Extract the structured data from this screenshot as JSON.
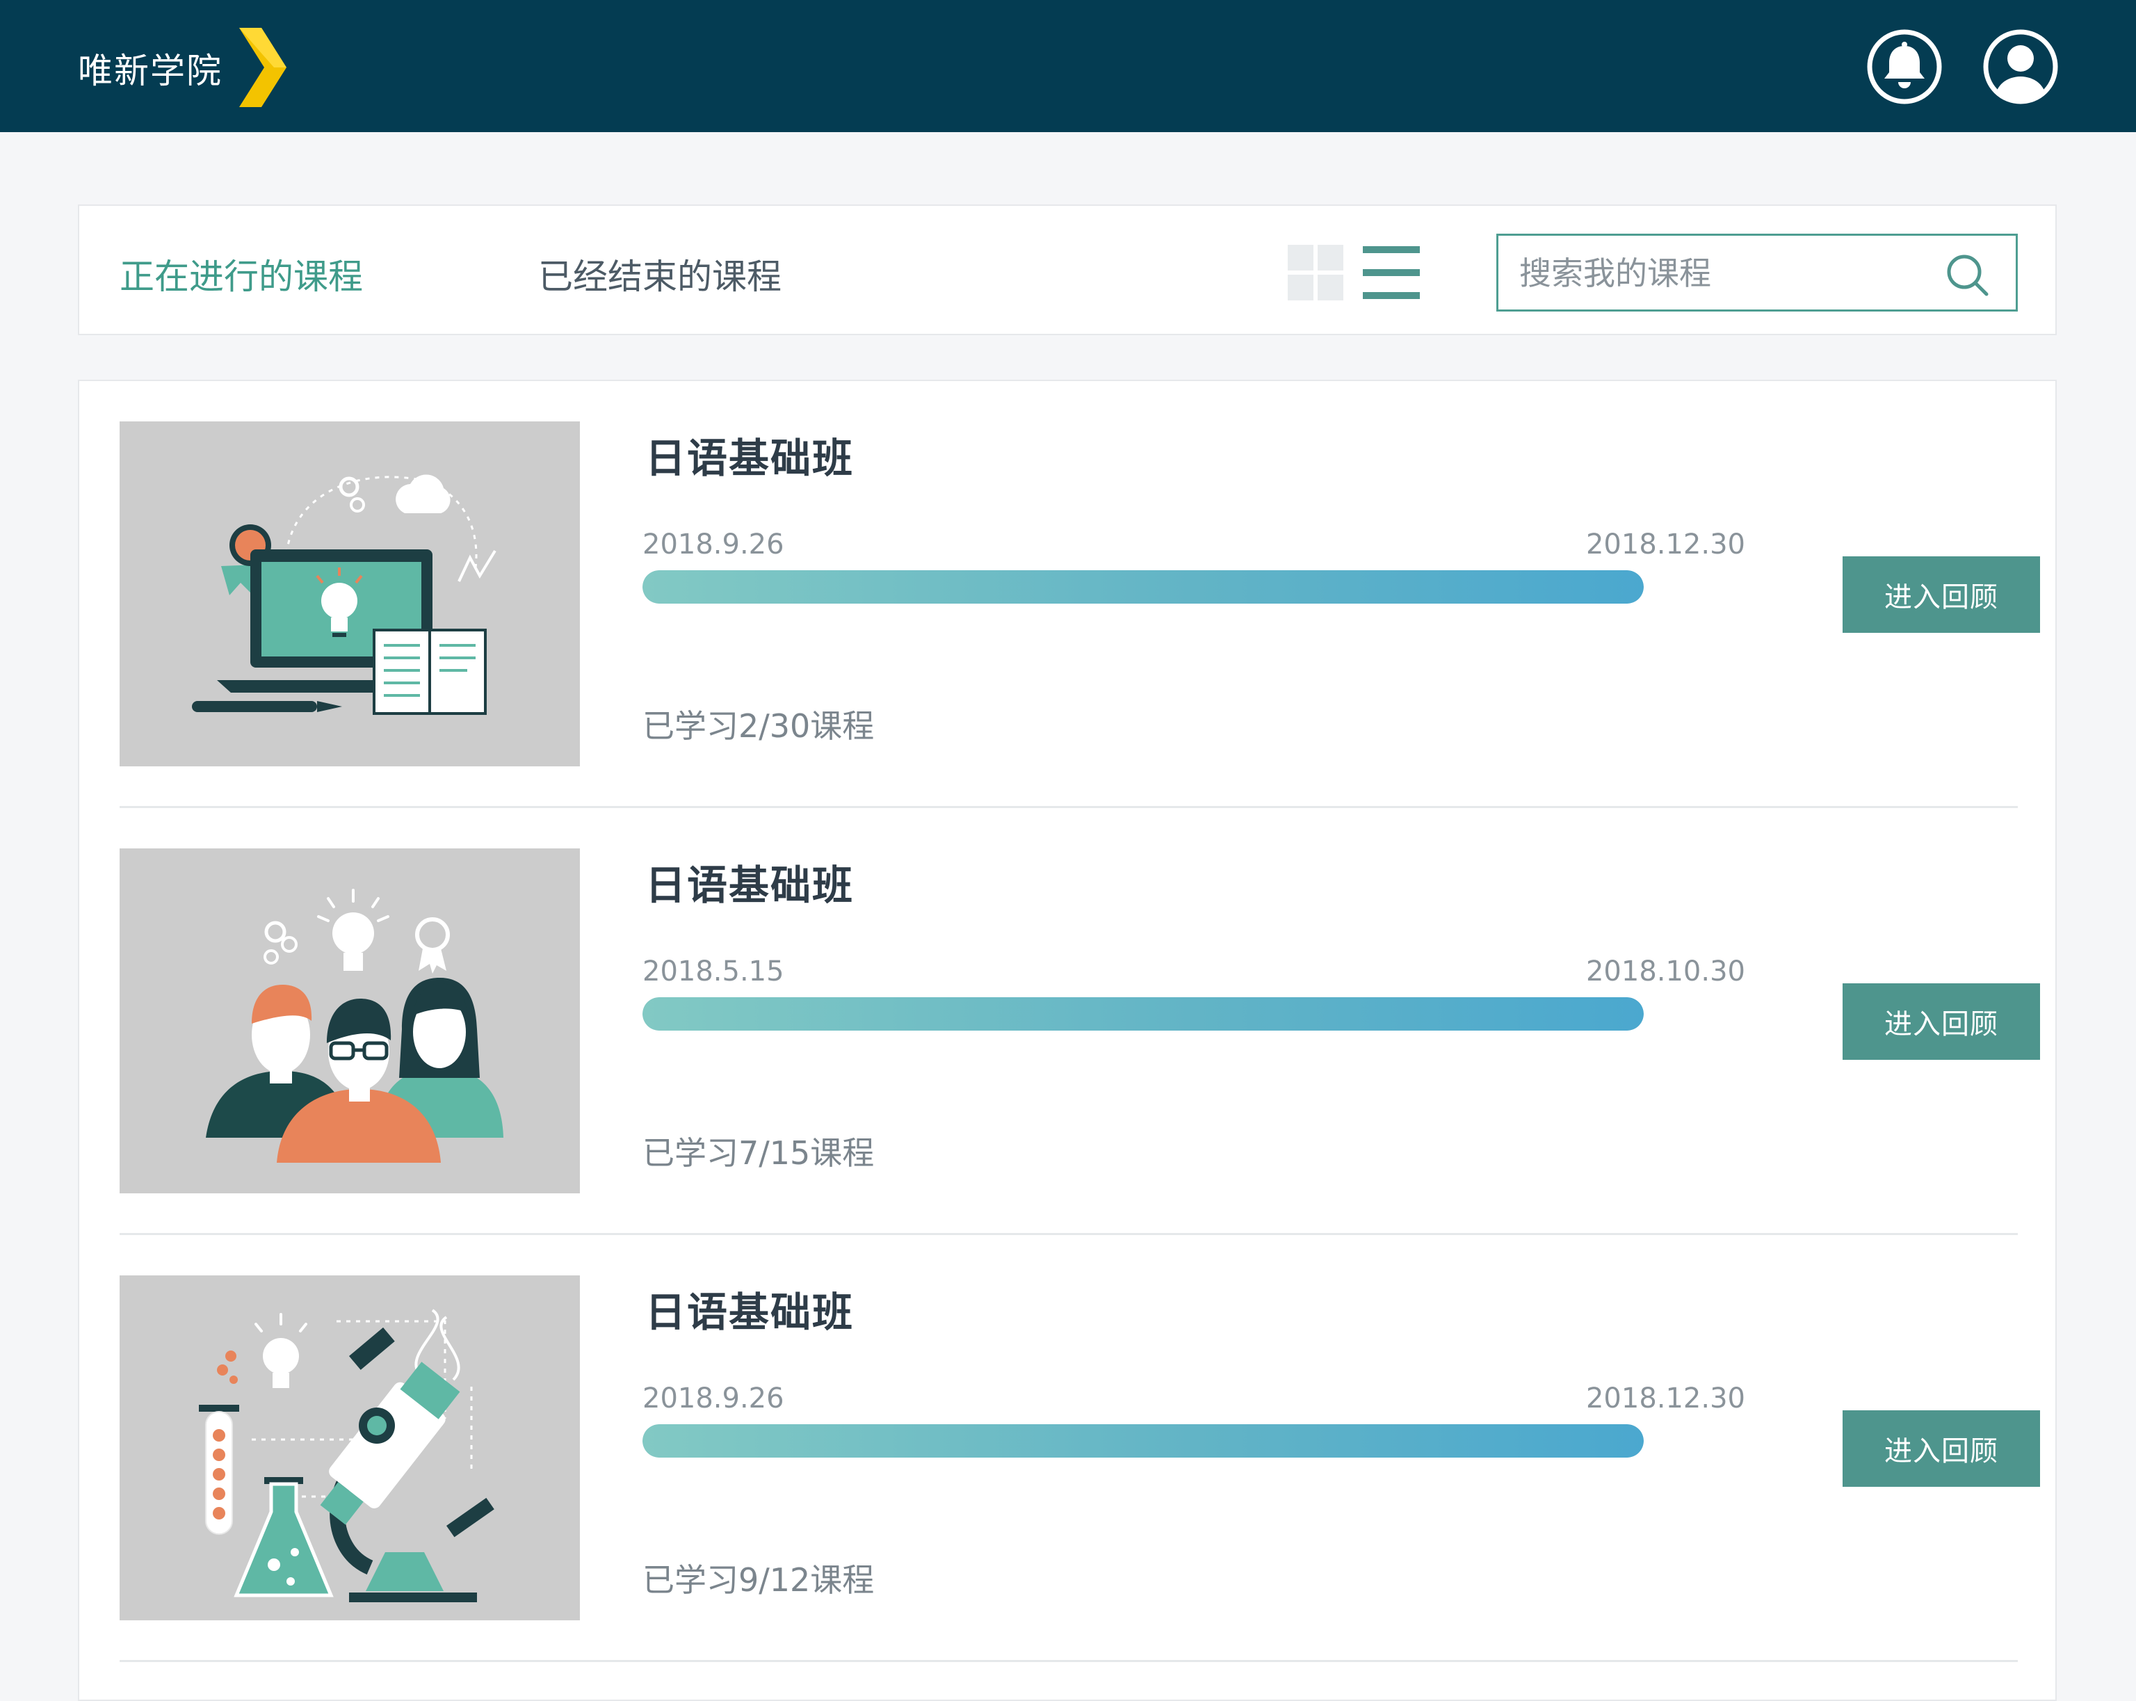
{
  "header": {
    "brand": "唯新学院",
    "brand_accent_color": "#f3c300",
    "background_color": "#043c52",
    "icons": [
      "bell-icon",
      "user-icon"
    ]
  },
  "toolbar": {
    "tabs": [
      {
        "label": "正在进行的课程",
        "active": true
      },
      {
        "label": "已经结束的课程",
        "active": false
      }
    ],
    "view_modes": [
      "grid-view-icon",
      "list-view-icon"
    ],
    "active_view": "list",
    "search_placeholder": "搜索我的课程",
    "accent_color": "#3f9b8a"
  },
  "courses": [
    {
      "title": "日语基础班",
      "start_date": "2018.9.26",
      "end_date": "2018.12.30",
      "progress_text": "已学习2/30课程",
      "progress": 1.0,
      "button_label": "进入回顾",
      "illustration": "laptop-education-illustration"
    },
    {
      "title": "日语基础班",
      "start_date": "2018.5.15",
      "end_date": "2018.10.30",
      "progress_text": "已学习7/15课程",
      "progress": 1.0,
      "button_label": "进入回顾",
      "illustration": "team-people-illustration"
    },
    {
      "title": "日语基础班",
      "start_date": "2018.9.26",
      "end_date": "2018.12.30",
      "progress_text": "已学习9/12课程",
      "progress": 1.0,
      "button_label": "进入回顾",
      "illustration": "science-lab-illustration"
    }
  ]
}
